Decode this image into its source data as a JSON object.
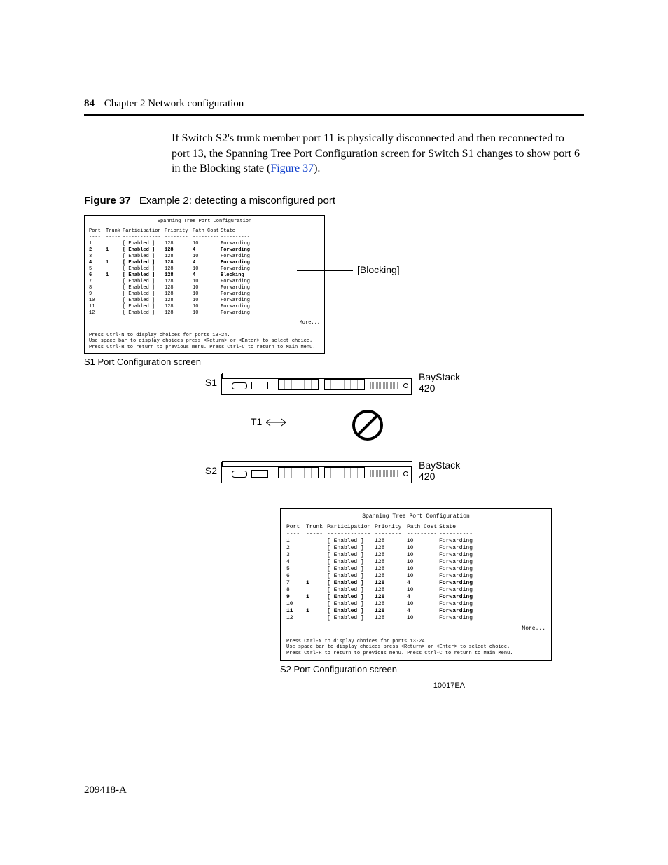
{
  "header": {
    "page_number": "84",
    "chapter": "Chapter 2  Network configuration"
  },
  "paragraph": {
    "text_before_link": "If Switch S2's trunk member port 11 is physically disconnected and then reconnected to port 13, the Spanning Tree Port Configuration screen for Switch S1 changes to show port 6 in the Blocking state (",
    "link_text": "Figure 37",
    "text_after_link": ")."
  },
  "figure_caption": {
    "label": "Figure 37",
    "title": "Example 2: detecting a misconfigured port"
  },
  "callout": "[Blocking]",
  "table_title": "Spanning Tree Port Configuration",
  "columns": [
    "Port",
    "Trunk",
    "Participation",
    "Priority",
    "Path Cost",
    "State"
  ],
  "dashes": [
    "----",
    "-----",
    "-------------",
    "--------",
    "---------",
    "----------"
  ],
  "s1_rows": [
    {
      "port": "1",
      "trunk": "",
      "part": "[ Enabled ]",
      "prio": "128",
      "cost": "10",
      "state": "Forwarding",
      "bold": false
    },
    {
      "port": "2",
      "trunk": "1",
      "part": "[ Enabled ]",
      "prio": "128",
      "cost": "4",
      "state": "Forwarding",
      "bold": true
    },
    {
      "port": "3",
      "trunk": "",
      "part": "[ Enabled ]",
      "prio": "128",
      "cost": "10",
      "state": "Forwarding",
      "bold": false
    },
    {
      "port": "4",
      "trunk": "1",
      "part": "[ Enabled ]",
      "prio": "128",
      "cost": "4",
      "state": "Forwarding",
      "bold": true
    },
    {
      "port": "5",
      "trunk": "",
      "part": "[ Enabled ]",
      "prio": "128",
      "cost": "10",
      "state": "Forwarding",
      "bold": false
    },
    {
      "port": "6",
      "trunk": "1",
      "part": "[ Enabled ]",
      "prio": "128",
      "cost": "4",
      "state": "Blocking",
      "bold": true
    },
    {
      "port": "7",
      "trunk": "",
      "part": "[ Enabled ]",
      "prio": "128",
      "cost": "10",
      "state": "Forwarding",
      "bold": false
    },
    {
      "port": "8",
      "trunk": "",
      "part": "[ Enabled ]",
      "prio": "128",
      "cost": "10",
      "state": "Forwarding",
      "bold": false
    },
    {
      "port": "9",
      "trunk": "",
      "part": "[ Enabled ]",
      "prio": "128",
      "cost": "10",
      "state": "Forwarding",
      "bold": false
    },
    {
      "port": "10",
      "trunk": "",
      "part": "[ Enabled ]",
      "prio": "128",
      "cost": "10",
      "state": "Forwarding",
      "bold": false
    },
    {
      "port": "11",
      "trunk": "",
      "part": "[ Enabled ]",
      "prio": "128",
      "cost": "10",
      "state": "Forwarding",
      "bold": false
    },
    {
      "port": "12",
      "trunk": "",
      "part": "[ Enabled ]",
      "prio": "128",
      "cost": "10",
      "state": "Forwarding",
      "bold": false
    }
  ],
  "s2_rows": [
    {
      "port": "1",
      "trunk": "",
      "part": "[ Enabled ]",
      "prio": "128",
      "cost": "10",
      "state": "Forwarding",
      "bold": false
    },
    {
      "port": "2",
      "trunk": "",
      "part": "[ Enabled ]",
      "prio": "128",
      "cost": "10",
      "state": "Forwarding",
      "bold": false
    },
    {
      "port": "3",
      "trunk": "",
      "part": "[ Enabled ]",
      "prio": "128",
      "cost": "10",
      "state": "Forwarding",
      "bold": false
    },
    {
      "port": "4",
      "trunk": "",
      "part": "[ Enabled ]",
      "prio": "128",
      "cost": "10",
      "state": "Forwarding",
      "bold": false
    },
    {
      "port": "5",
      "trunk": "",
      "part": "[ Enabled ]",
      "prio": "128",
      "cost": "10",
      "state": "Forwarding",
      "bold": false
    },
    {
      "port": "6",
      "trunk": "",
      "part": "[ Enabled ]",
      "prio": "128",
      "cost": "10",
      "state": "Forwarding",
      "bold": false
    },
    {
      "port": "7",
      "trunk": "1",
      "part": "[ Enabled ]",
      "prio": "128",
      "cost": "4",
      "state": "Forwarding",
      "bold": true
    },
    {
      "port": "8",
      "trunk": "",
      "part": "[ Enabled ]",
      "prio": "128",
      "cost": "10",
      "state": "Forwarding",
      "bold": false
    },
    {
      "port": "9",
      "trunk": "1",
      "part": "[ Enabled ]",
      "prio": "128",
      "cost": "4",
      "state": "Forwarding",
      "bold": true
    },
    {
      "port": "10",
      "trunk": "",
      "part": "[ Enabled ]",
      "prio": "128",
      "cost": "10",
      "state": "Forwarding",
      "bold": false
    },
    {
      "port": "11",
      "trunk": "1",
      "part": "[ Enabled ]",
      "prio": "128",
      "cost": "4",
      "state": "Forwarding",
      "bold": true
    },
    {
      "port": "12",
      "trunk": "",
      "part": "[ Enabled ]",
      "prio": "128",
      "cost": "10",
      "state": "Forwarding",
      "bold": false
    }
  ],
  "more": "More...",
  "footer_hints": {
    "line1": "Press Ctrl-N to display choices for ports 13-24.",
    "line2": "Use space bar to display choices press <Return> or <Enter> to select choice.",
    "line3": "Press Ctrl-R to return to previous menu.  Press Ctrl-C to return to Main Menu."
  },
  "s1_caption": "S1 Port Configuration screen",
  "s2_caption": "S2 Port Configuration screen",
  "diagram": {
    "s1": "S1",
    "s2": "S2",
    "device1": "BayStack 420",
    "device2": "BayStack 420",
    "trunk": "T1"
  },
  "ref_code": "10017EA",
  "footer": "209418-A"
}
